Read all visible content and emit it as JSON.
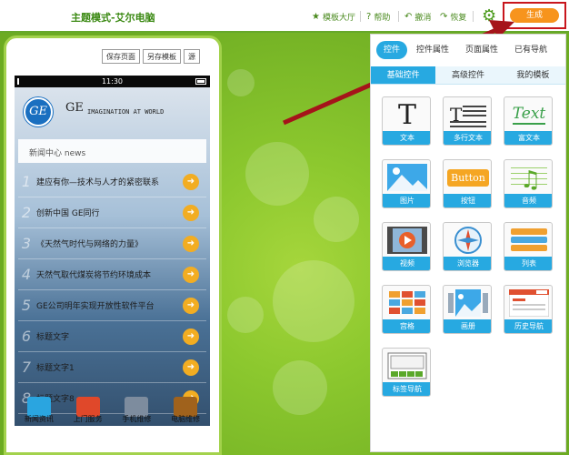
{
  "header": {
    "title": "主题模式-艾尔电脑",
    "links": [
      {
        "icon": "star-icon",
        "label": "模板大厅"
      },
      {
        "icon": "help-icon",
        "label": "帮助"
      },
      {
        "icon": "undo-icon",
        "label": "撤消"
      },
      {
        "icon": "redo-icon",
        "label": "恢复"
      }
    ],
    "generate_label": "生成"
  },
  "phone": {
    "actions": [
      "保存页面",
      "另存模板",
      "源"
    ],
    "status_time": "11:30",
    "brand": "GE",
    "brand_logo_text": "GE",
    "tagline": "IMAGINATION AT WORLD",
    "news_header": "新闻中心 news",
    "news": [
      {
        "num": "1",
        "title": "建应有你—技术与人才的紧密联系"
      },
      {
        "num": "2",
        "title": "创新中国 GE同行"
      },
      {
        "num": "3",
        "title": "《天然气时代与网络的力量》"
      },
      {
        "num": "4",
        "title": "天然气取代煤炭将节约环境成本"
      },
      {
        "num": "5",
        "title": "GE公司明年实现开放性软件平台"
      },
      {
        "num": "6",
        "title": "标题文字"
      },
      {
        "num": "7",
        "title": "标题文字1"
      },
      {
        "num": "8",
        "title": "标题文字8"
      }
    ],
    "bottom_nav": [
      "新闻资讯",
      "上门服务",
      "手机维修",
      "电脑维修"
    ]
  },
  "panel": {
    "tabs": [
      "控件",
      "控件属性",
      "页面属性",
      "已有导航"
    ],
    "active_tab": 0,
    "subtabs": [
      "基础控件",
      "高级控件",
      "我的模板"
    ],
    "active_subtab": 0,
    "controls": [
      {
        "icon": "text-icon",
        "label": "文本"
      },
      {
        "icon": "multiline-text-icon",
        "label": "多行文本"
      },
      {
        "icon": "rich-text-icon",
        "label": "富文本"
      },
      {
        "icon": "image-icon",
        "label": "图片"
      },
      {
        "icon": "button-icon",
        "label": "按钮"
      },
      {
        "icon": "audio-icon",
        "label": "音频"
      },
      {
        "icon": "video-icon",
        "label": "视频"
      },
      {
        "icon": "browser-icon",
        "label": "浏览器"
      },
      {
        "icon": "list-icon",
        "label": "列表"
      },
      {
        "icon": "grid-icon",
        "label": "宫格"
      },
      {
        "icon": "gallery-icon",
        "label": "画册"
      },
      {
        "icon": "history-nav-icon",
        "label": "历史导航"
      },
      {
        "icon": "tab-nav-icon",
        "label": "标签导航"
      }
    ],
    "button_glyph_text": "Button",
    "text_glyph": "T",
    "rich_text_glyph": "Text"
  },
  "colors": {
    "accent_blue": "#27a9e1",
    "generate_orange": "#f7941d",
    "highlight_red": "#c8161d",
    "brand_green": "#3c8a14"
  }
}
